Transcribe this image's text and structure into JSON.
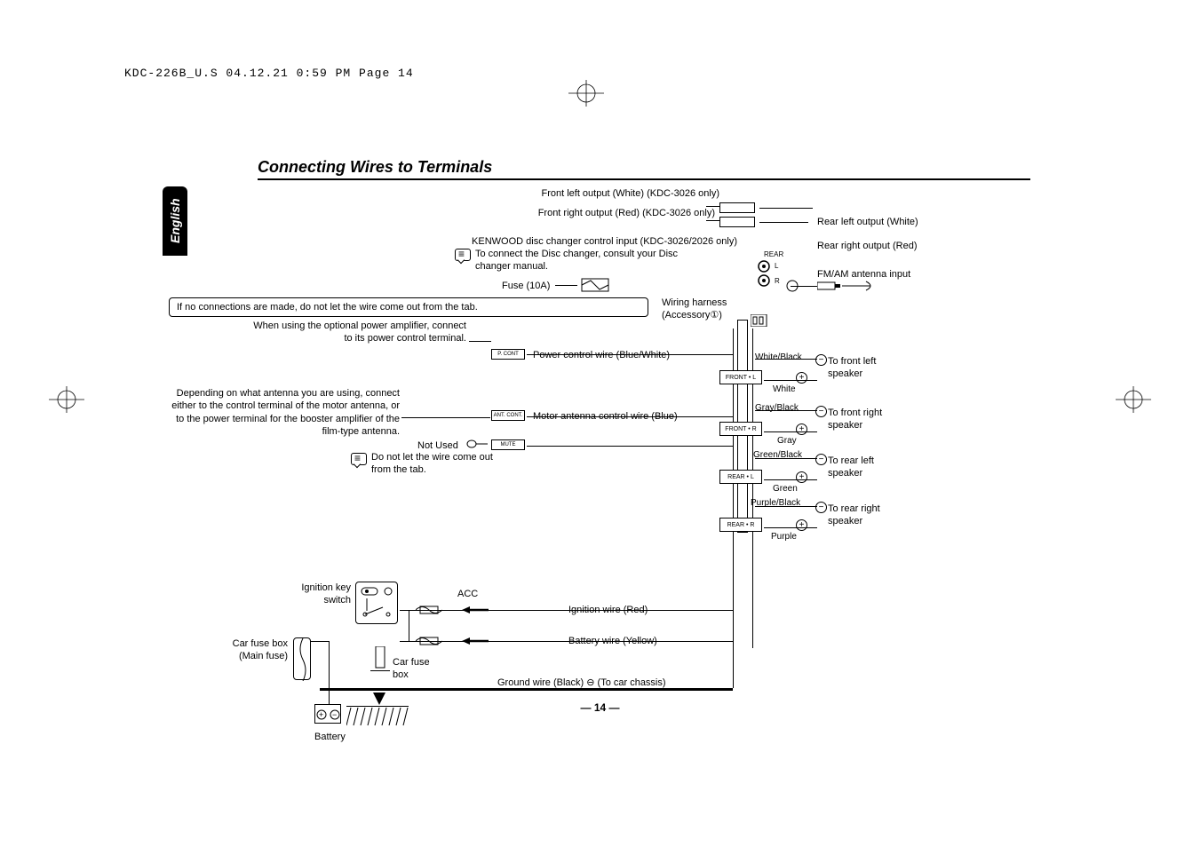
{
  "header": "KDC-226B_U.S  04.12.21  0:59 PM  Page 14",
  "title": "Connecting Wires to Terminals",
  "lang": "English",
  "page_num": "— 14 —",
  "labels": {
    "front_left_out": "Front left output (White) (KDC-3026 only)",
    "front_right_out": "Front right output (Red) (KDC-3026 only)",
    "kenwood_changer": "KENWOOD disc changer control input (KDC-3026/2026 only)",
    "disc_note": "To connect the Disc changer, consult your Disc changer manual.",
    "fuse": "Fuse (10A)",
    "no_conn_warn": "If no connections are made, do not let the wire come out from the tab.",
    "power_amp_note": "When using the optional power amplifier, connect to its power control terminal.",
    "antenna_note": "Depending on what antenna you are using, connect either to the control terminal of the motor antenna, or to the power terminal for the booster amplifier of the film-type antenna.",
    "not_used": "Not Used",
    "no_tab_note": "Do not let the wire come out from the tab.",
    "ign_switch": "Ignition key switch",
    "car_fuse_main": "Car fuse box (Main fuse)",
    "car_fuse": "Car fuse box",
    "battery": "Battery",
    "acc": "ACC",
    "rear_left_out": "Rear left output (White)",
    "rear_right_out": "Rear right output (Red)",
    "fm_am": "FM/AM antenna input",
    "wiring_harness": "Wiring harness (Accessory①)",
    "power_ctrl": "Power control wire (Blue/White)",
    "motor_ant": "Motor antenna control wire (Blue)",
    "ign_wire": "Ignition wire (Red)",
    "batt_wire": "Battery wire (Yellow)",
    "ground_wire": "Ground wire (Black) ⊖ (To car chassis)",
    "rear_tag": "REAR",
    "white_black": "White/Black",
    "white": "White",
    "gray_black": "Gray/Black",
    "gray": "Gray",
    "green_black": "Green/Black",
    "green": "Green",
    "purple_black": "Purple/Black",
    "purple": "Purple",
    "front_left_spk": "To front left speaker",
    "front_right_spk": "To front right speaker",
    "rear_left_spk": "To rear left speaker",
    "rear_right_spk": "To rear right speaker",
    "front_l_box": "FRONT • L",
    "front_r_box": "FRONT • R",
    "rear_l_box": "REAR • L",
    "rear_r_box": "REAR • R",
    "pcont": "P. CONT",
    "antcont": "ANT. CONT.",
    "mute": "MUTE",
    "l": "L",
    "r": "R"
  }
}
